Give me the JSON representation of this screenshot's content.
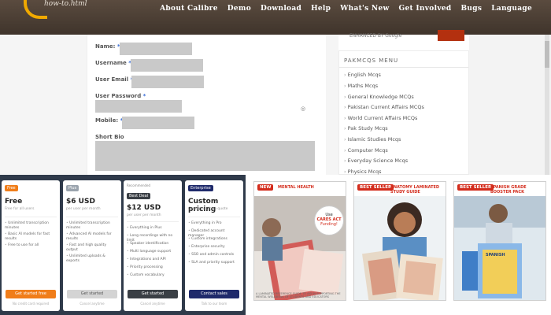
{
  "header": {
    "logo_text": "how-to.html",
    "nav": [
      "About Calibre",
      "Demo",
      "Download",
      "Help",
      "What's New",
      "Get Involved",
      "Bugs",
      "Language"
    ],
    "search_label": "ENHANCED BY Google"
  },
  "form": {
    "name_label": "Name:",
    "username_label": "Username",
    "email_label": "User Email",
    "password_label": "User Password",
    "mobile_label": "Mobile:",
    "bio_label": "Short Bio",
    "required_mark": "*"
  },
  "sidebar": {
    "title": "PAKMCQS MENU",
    "items": [
      "English Mcqs",
      "Maths Mcqs",
      "General Knowledge MCQs",
      "Pakistan Current Affairs MCQs",
      "World Current Affairs MCQs",
      "Pak Study Mcqs",
      "Islamic Studies Mcqs",
      "Computer Mcqs",
      "Everyday Science Mcqs",
      "Physics Mcqs"
    ]
  },
  "pricing": [
    {
      "badge": "Free",
      "badge_color": "#f07d19",
      "name": "Free",
      "sub": "Free for all users",
      "features": [
        "Unlimited transcription minutes",
        "Basic AI models for fast results",
        "Free to use for all"
      ],
      "button": "Get started free",
      "button_color": "#f07d19",
      "foot": "No credit card required"
    },
    {
      "badge": "Plus",
      "badge_color": "#9aa3ad",
      "name": "$6 USD",
      "sub": "per user per month",
      "features": [
        "Unlimited transcription minutes",
        "Advanced AI models for results",
        "Fast and high quality output",
        "Unlimited uploads & exports"
      ],
      "button": "Get started",
      "button_color": "#d4d4d4",
      "foot": "Cancel anytime"
    },
    {
      "badge": "Best Deal",
      "badge_color": "#3a3f45",
      "corner": "Recommended",
      "name": "$12 USD",
      "sub": "per user per month",
      "features": [
        "Everything in Plus",
        "Long recordings with no limit",
        "Speaker identification",
        "Multi language support",
        "Integrations and API",
        "Priority processing",
        "Custom vocabulary"
      ],
      "button": "Get started",
      "button_color": "#3a3f45",
      "foot": "Cancel anytime"
    },
    {
      "badge": "Enterprise",
      "badge_color": "#1f2a6b",
      "name": "Custom pricing",
      "sub": "Contact us for a quote",
      "features": [
        "Everything in Pro",
        "Dedicated account manager",
        "Custom integrations",
        "Enterprise security",
        "SSO and admin controls",
        "SLA and priority support"
      ],
      "button": "Contact sales",
      "button_color": "#1f2a6b",
      "foot": "Talk to our team"
    }
  ],
  "products": [
    {
      "badge": "NEW",
      "title": "MENTAL HEALTH",
      "cares_line1": "Use",
      "cares_line2": "CARES ACT",
      "cares_line3": "Funding!",
      "caption": "A LAMINATED REFERENCE GUIDE TO AID IN SUPPORTING THE MENTAL WELLBEING OF STUDENTS AND EDUCATORS"
    },
    {
      "badge": "BEST SELLER",
      "title": "ANATOMY LAMINATED STUDY GUIDE"
    },
    {
      "badge": "BEST SELLER",
      "title": "SPANISH GRADE BOOSTER PACK",
      "book_label": "SPANISH"
    }
  ]
}
